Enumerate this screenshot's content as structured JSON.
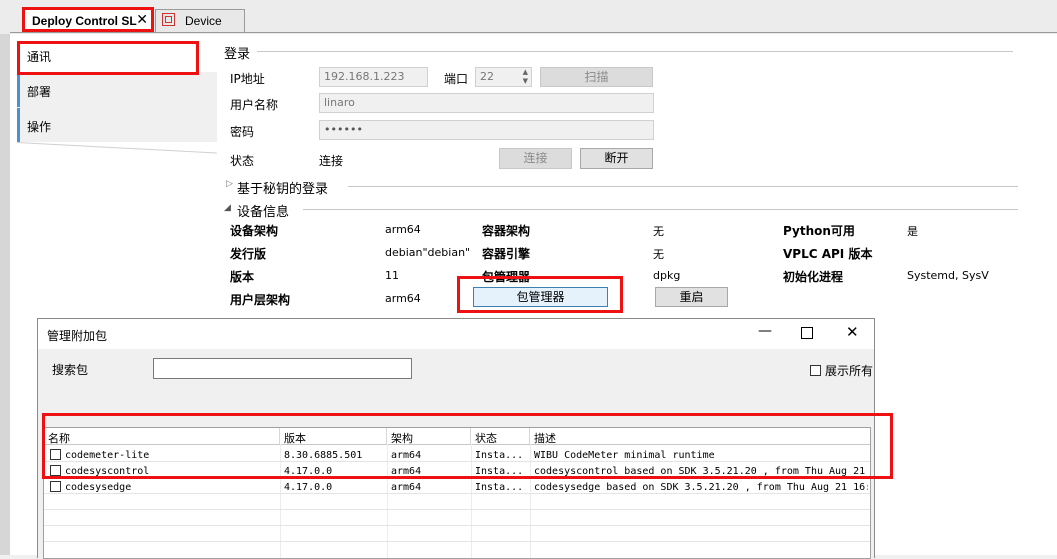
{
  "tabs": {
    "deploy": "Deploy Control SL",
    "device": "Device",
    "close_glyph": "✕"
  },
  "sidebar": {
    "items": [
      {
        "label": "通讯"
      },
      {
        "label": "部署"
      },
      {
        "label": "操作"
      }
    ]
  },
  "login": {
    "section_title": "登录",
    "ip_label": "IP地址",
    "ip_value": "192.168.1.223",
    "port_label": "端口",
    "port_value": "22",
    "scan_button": "扫描",
    "user_label": "用户名称",
    "user_value": "linaro",
    "password_label": "密码",
    "password_value": "••••••",
    "status_label": "状态",
    "status_value": "连接",
    "connect_button": "连接",
    "disconnect_button": "断开"
  },
  "key_login": {
    "section_title": "基于秘钥的登录"
  },
  "device_info": {
    "section_title": "设备信息",
    "arch_label": "设备架构",
    "arch_value": "arm64",
    "container_arch_label": "容器架构",
    "container_arch_value": "无",
    "python_label": "Python可用",
    "python_value": "是",
    "distro_label": "发行版",
    "distro_value": "debian\"debian\"",
    "container_engine_label": "容器引擎",
    "container_engine_value": "无",
    "vplc_label": "VPLC API 版本",
    "vplc_value": "",
    "version_label": "版本",
    "version_value": "11",
    "pkg_mgr_label": "包管理器",
    "pkg_mgr_value": "dpkg",
    "init_label": "初始化进程",
    "init_value": "Systemd, SysV",
    "userland_label": "用户层架构",
    "userland_value": "arm64",
    "pkg_mgr_button": "包管理器",
    "restart_button": "重启"
  },
  "dialog": {
    "title": "管理附加包",
    "search_label": "搜索包",
    "search_value": "",
    "show_all_label": "展示所有",
    "columns": [
      "名称",
      "版本",
      "架构",
      "状态",
      "描述"
    ],
    "rows": [
      {
        "name": "codemeter-lite",
        "version": "8.30.6885.501",
        "arch": "arm64",
        "status": "Insta...",
        "desc": "WIBU CodeMeter minimal runtime"
      },
      {
        "name": "codesyscontrol",
        "version": "4.17.0.0",
        "arch": "arm64",
        "status": "Insta...",
        "desc": "codesyscontrol based on SDK 3.5.21.20 , from Thu Aug 21"
      },
      {
        "name": "codesysedge",
        "version": "4.17.0.0",
        "arch": "arm64",
        "status": "Insta...",
        "desc": "codesysedge based on SDK 3.5.21.20 , from Thu Aug 21 16:"
      }
    ]
  }
}
